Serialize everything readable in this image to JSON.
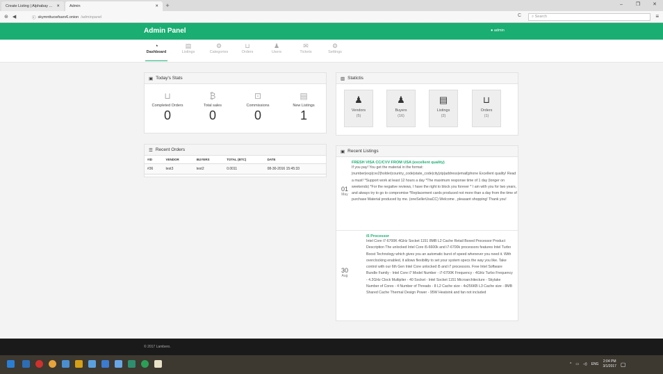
{
  "browser": {
    "tab1": "Create Listing | Alphabay ...",
    "tab2": "Admin",
    "url_host": "skymnttucwfsarv6.onion",
    "url_path": "/adminpanel",
    "search_placeholder": "Search",
    "reload": "C"
  },
  "header": {
    "title": "Admin Panel",
    "user": "admin"
  },
  "nav": [
    {
      "label": "Dashboard",
      "icon": "dashboard-icon"
    },
    {
      "label": "Listings",
      "icon": "listings-icon"
    },
    {
      "label": "Categories",
      "icon": "cog-icon"
    },
    {
      "label": "Orders",
      "icon": "cart-icon"
    },
    {
      "label": "Users",
      "icon": "user-icon"
    },
    {
      "label": "Tickets",
      "icon": "envelope-icon"
    },
    {
      "label": "Settings",
      "icon": "cog-icon"
    }
  ],
  "today": {
    "title": "Today's Stats",
    "stats": [
      {
        "label": "Completed Orders",
        "value": "0"
      },
      {
        "label": "Total sales",
        "value": "0"
      },
      {
        "label": "Commissions",
        "value": "0"
      },
      {
        "label": "New Listings",
        "value": "1"
      }
    ]
  },
  "statistics": {
    "title": "Statictis",
    "boxes": [
      {
        "label": "Vendors",
        "count": "(5)"
      },
      {
        "label": "Buyers",
        "count": "(16)"
      },
      {
        "label": "Listings",
        "count": "(2)"
      },
      {
        "label": "Orders",
        "count": "(1)"
      }
    ]
  },
  "orders": {
    "title": "Recent Orders",
    "headers": [
      "#ID",
      "VENDOR",
      "BUYERS",
      "TOTAL (BTC)",
      "DATE"
    ],
    "rows": [
      [
        "#36",
        "test3",
        "test2",
        "0.0011",
        "08-30-2016 15:45:33"
      ]
    ]
  },
  "listings": {
    "title": "Recent Listings",
    "items": [
      {
        "day": "01",
        "month": "May",
        "title": "FRESH VISA CC/CVV FROM USA (excellent quality)",
        "desc": "If you pay! You get the material in the format: |number|exp|cvv2|holder|country_code|state_code|city|zip|address|email|phone Excellent quality! Read a must! *Support work at least 12 hours a day *The maximum response time of 1 day (longer on weekends) *For the negative reviews, I have the right to block you forever * I am with you for two years, and always try to go to compromise *Replacement cards produced not more than a day from the time of purchase Material produced by me. (oneSellerUsaCC) Welcome , pleasant shopping! Thank you!"
      },
      {
        "day": "30",
        "month": "Aug",
        "title": "i5 Processor",
        "desc": "Intel Core i7-6700K 4GHz Socket 1151 8MB L2 Cache Retail Boxed Processor Product Description The unlocked Intel Core i5-6600k and i7-6700k processors features Intel Turbo Boost Technology which gives you an automatic burst of speed whenever you need it. With overclocking enabled, it allows flexibility to set your system specs the way you like. Take control with our 6th Gen Intel Core unlocked i5 and i7 processors. Free Intel Software Bundle Family - Intel Core i7 Model Number - i7-6700K Frequency - 4GHz Turbo Frequency - 4.2GHz Clock Multiplier - 40 Socket - Intel Socket 1151 Microarchitecture - Skylake Number of Cores - 4 Number of Threads - 8 L2 Cache size - 4x256KB L3 Cache size - 8MB Shared Cache Thermal Design Power - 95W Heatsink and fan not included"
      }
    ]
  },
  "footer": "© 2017 Lambero.",
  "taskbar": {
    "lang": "ENG",
    "time": "2:04 PM",
    "date": "3/1/2017"
  }
}
